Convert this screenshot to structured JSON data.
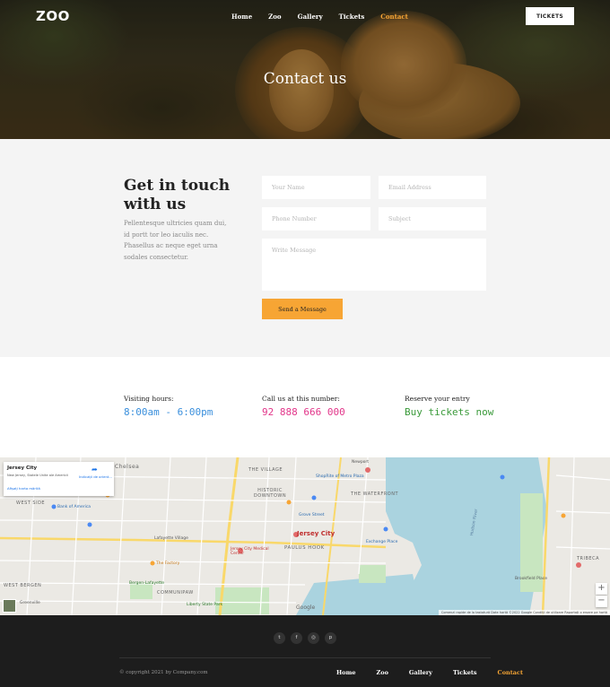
{
  "header": {
    "logo": "ZOO",
    "nav": [
      {
        "label": "Home",
        "active": false
      },
      {
        "label": "Zoo",
        "active": false
      },
      {
        "label": "Gallery",
        "active": false
      },
      {
        "label": "Tickets",
        "active": false
      },
      {
        "label": "Contact",
        "active": true
      }
    ],
    "tickets_button": "TICKETS",
    "hero_title": "Contact us"
  },
  "contact": {
    "title": "Get in touch with us",
    "text": "Pellentesque ultricies quam dui, id portt tor leo iaculis nec. Phasellus ac neque eget urna sodales consectetur.",
    "form": {
      "name_placeholder": "Your Name",
      "email_placeholder": "Email Address",
      "phone_placeholder": "Phone Number",
      "subject_placeholder": "Subject",
      "message_placeholder": "Write Message",
      "send_label": "Send a Message"
    }
  },
  "info": {
    "hours_label": "Visiting hours:",
    "hours_value": "8:00am - 6:00pm",
    "phone_label": "Call us at this number:",
    "phone_value": "92 888 666 000",
    "entry_label": "Reserve your entry",
    "entry_value": "Buy tickets now"
  },
  "map": {
    "card_title": "Jersey City",
    "card_subtitle": "New Jersey, Statele Unite ale Americii",
    "card_link": "Afișați harta mărită",
    "card_directions": "Indicații de orient...",
    "labels": [
      "The Village",
      "ShopRite of Metro Plaza",
      "Historic Downtown",
      "The Waterfront",
      "Jersey City",
      "Paulus Hook",
      "West Side",
      "Communipaw",
      "Lafayette Village",
      "Bank of America",
      "The Factory",
      "Jersey City Medical Center",
      "Exchange Place",
      "Tribeca",
      "Brookfield Place",
      "Liberty State Park",
      "Grove Street",
      "Newport",
      "Hudson River",
      "Bergen-Lafayette",
      "West Bergen",
      "Greenville",
      "Chelsea"
    ],
    "google": "Google",
    "attribution": "Comenzi rapide de la tastatură   Date hartă ©2022 Google   Condiții de utilizare   Raportați o eroare pe hartă",
    "zoom_in": "+",
    "zoom_out": "−"
  },
  "footer": {
    "social": [
      {
        "icon": "twitter-icon",
        "glyph": "t"
      },
      {
        "icon": "facebook-icon",
        "glyph": "f"
      },
      {
        "icon": "instagram-icon",
        "glyph": "◎"
      },
      {
        "icon": "pinterest-icon",
        "glyph": "p"
      }
    ],
    "copyright": "© copyright 2021 by Company.com",
    "nav": [
      {
        "label": "Home",
        "active": false
      },
      {
        "label": "Zoo",
        "active": false
      },
      {
        "label": "Gallery",
        "active": false
      },
      {
        "label": "Tickets",
        "active": false
      },
      {
        "label": "Contact",
        "active": true
      }
    ]
  },
  "colors": {
    "accent": "#f7a534",
    "hours": "#3a8fdc",
    "phone": "#e2368a",
    "entry": "#3a9a3a",
    "footer_bg": "#1d1d1d",
    "contact_bg": "#f4f4f4"
  }
}
